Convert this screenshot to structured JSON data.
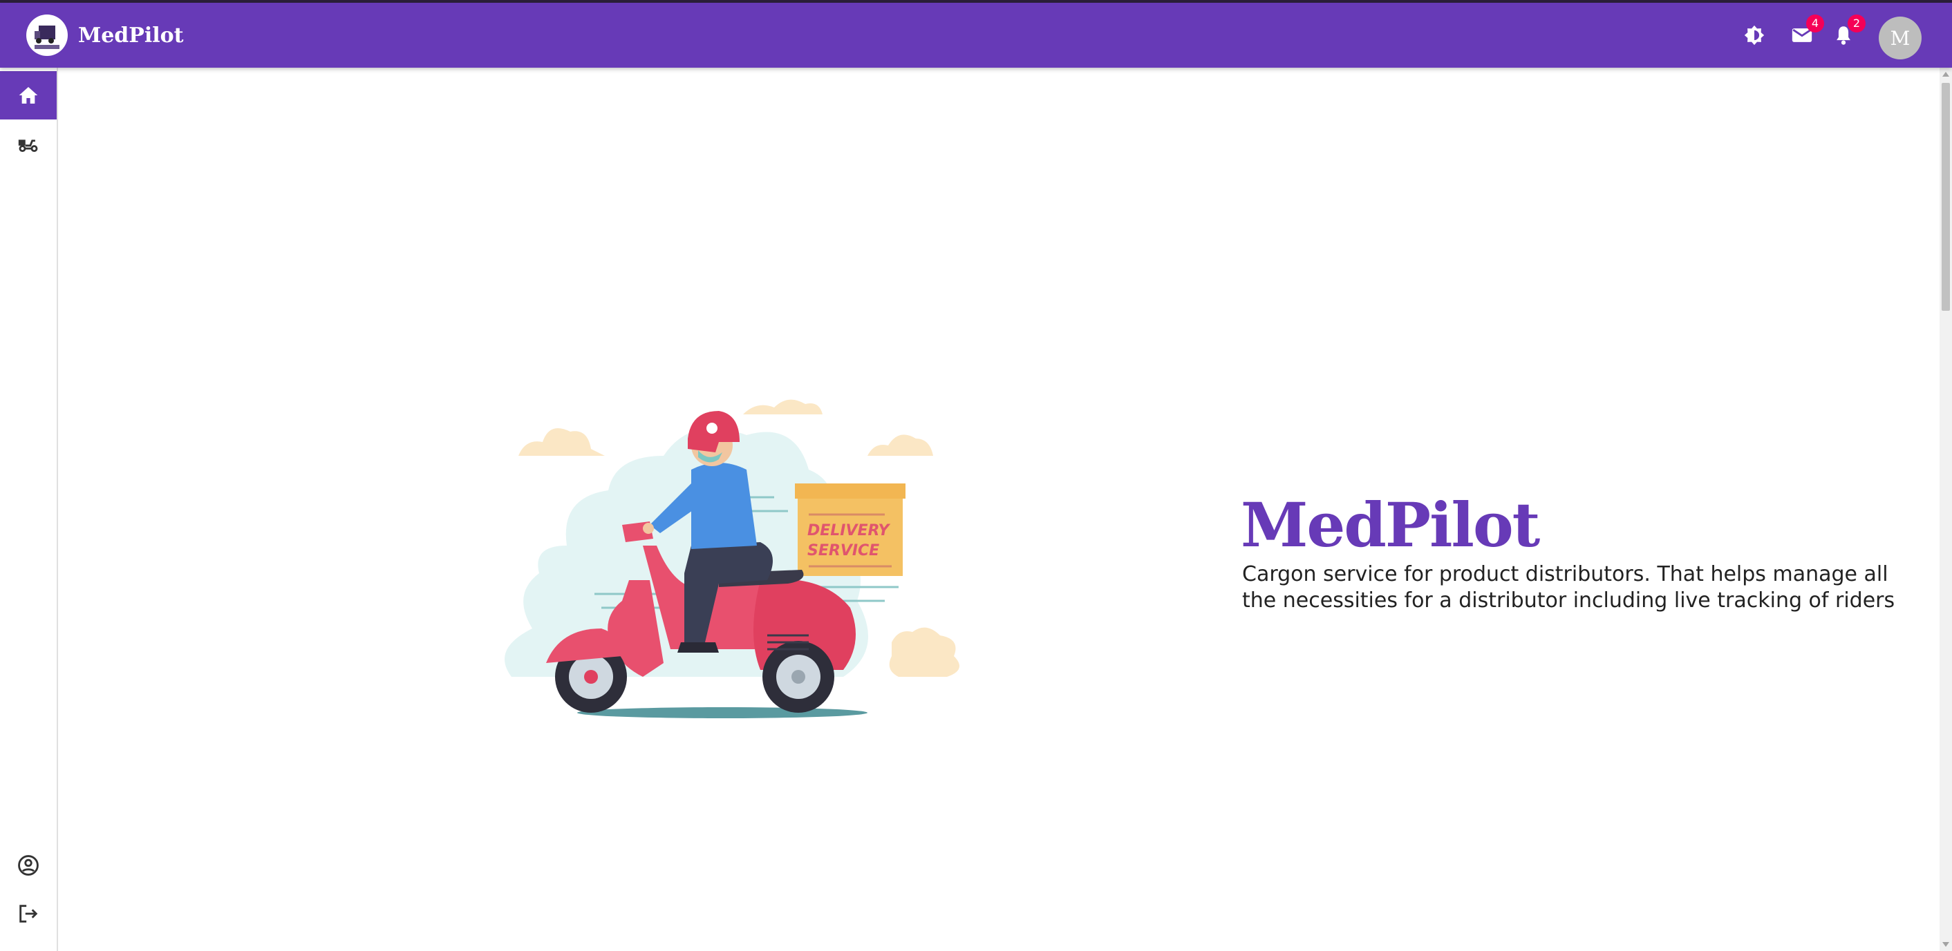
{
  "appbar": {
    "title": "MedPilot",
    "mail_count": "4",
    "notification_count": "2",
    "avatar_initial": "M"
  },
  "sidebar": {
    "items": [
      {
        "icon": "home-icon",
        "active": true
      },
      {
        "icon": "delivery-scooter-icon",
        "active": false
      }
    ],
    "bottom_items": [
      {
        "icon": "account-circle-icon"
      },
      {
        "icon": "logout-icon"
      }
    ]
  },
  "hero": {
    "title": "MedPilot",
    "description": "Cargon service for product distributors. That helps manage all the necessities for a distributor including live tracking of riders",
    "illustration_box_text_1": "DELIVERY",
    "illustration_box_text_2": "SERVICE"
  },
  "colors": {
    "primary": "#673ab7",
    "badge": "#f50057",
    "avatar": "#bdbdbd"
  }
}
